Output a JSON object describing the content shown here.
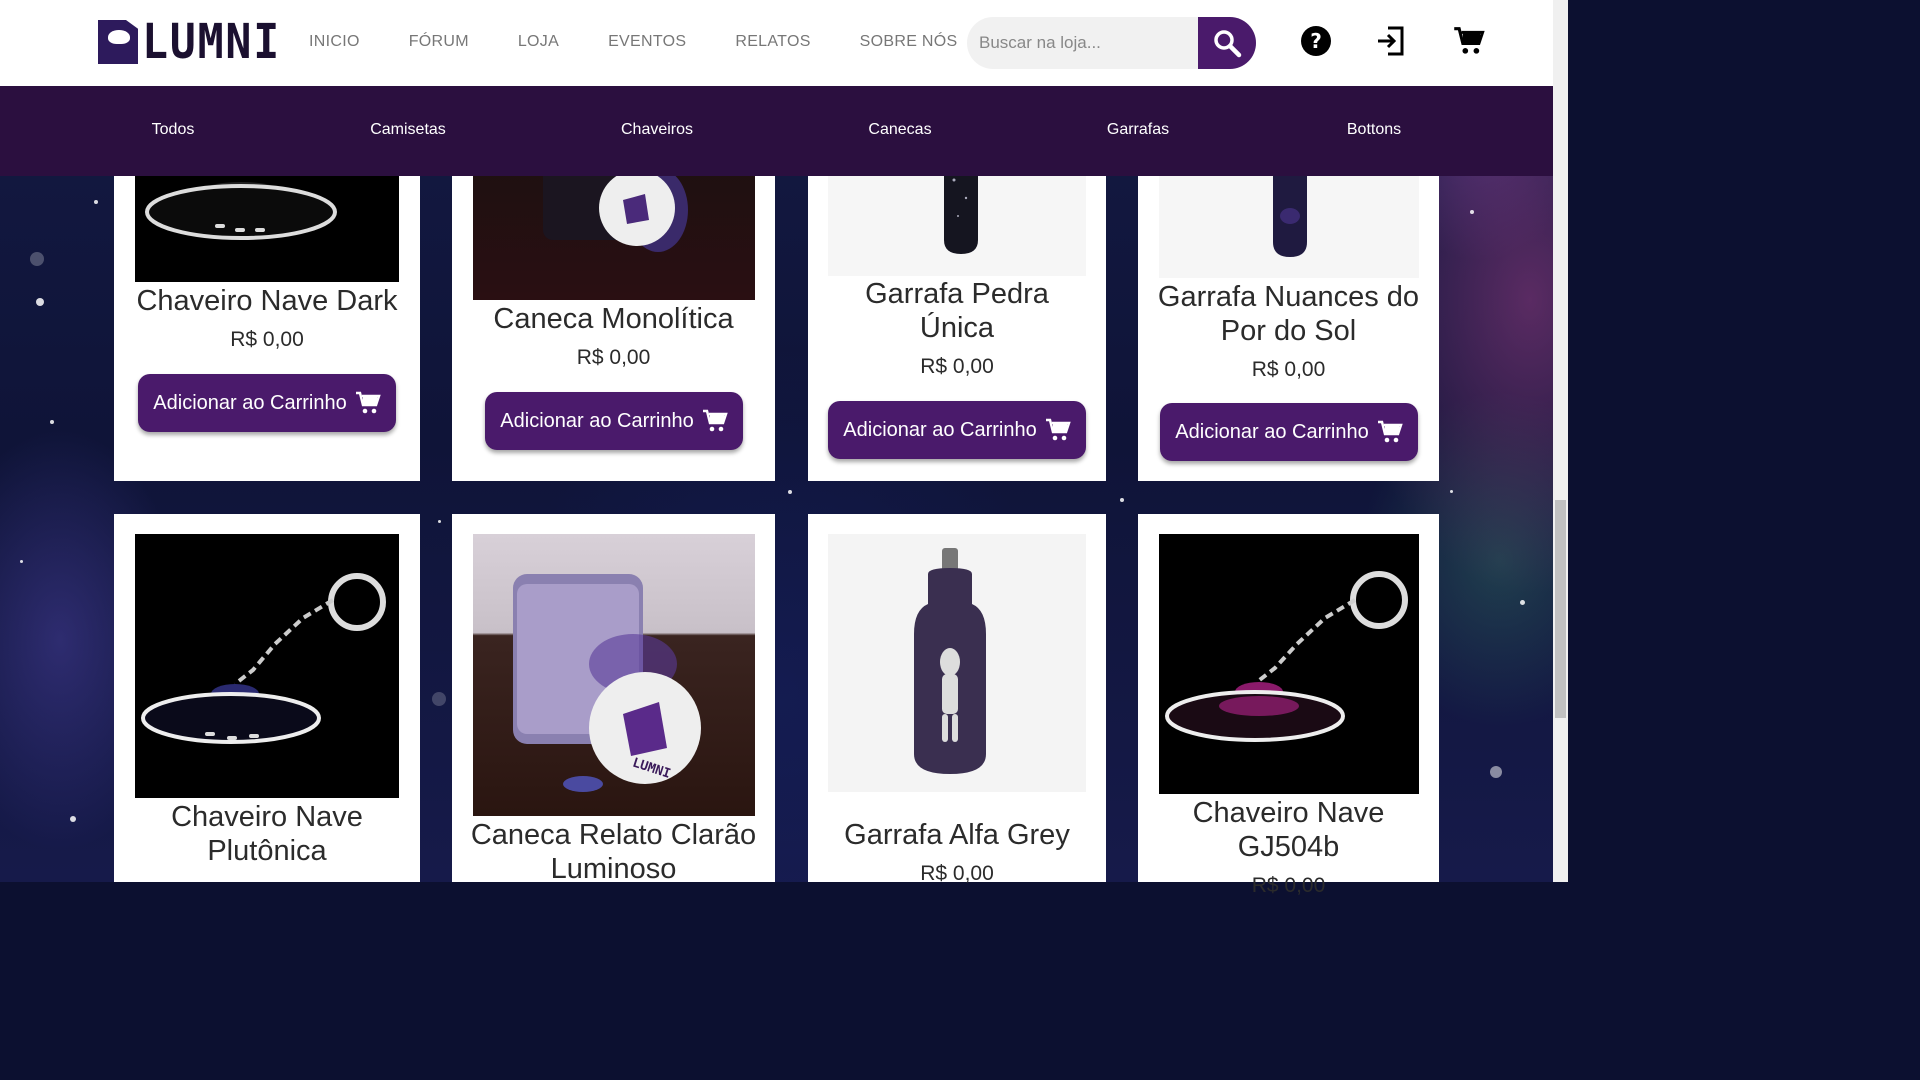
{
  "brand": {
    "logo_text": "LUMNI"
  },
  "nav": [
    "INICIO",
    "FÓRUM",
    "LOJA",
    "EVENTOS",
    "RELATOS",
    "SOBRE NÓS"
  ],
  "search": {
    "placeholder": "Buscar na loja..."
  },
  "header_icons": [
    "help-icon",
    "login-icon",
    "cart-icon"
  ],
  "categories": [
    "Todos",
    "Camisetas",
    "Chaveiros",
    "Canecas",
    "Garrafas",
    "Bottons"
  ],
  "products_row1": [
    {
      "name": "Chaveiro Nave Dark",
      "price": "R$ 0,00",
      "button": "Adicionar ao Carrinho"
    },
    {
      "name": "Caneca Monolítica",
      "price": "R$ 0,00",
      "button": "Adicionar ao Carrinho"
    },
    {
      "name": "Garrafa Pedra Única",
      "price": "R$ 0,00",
      "button": "Adicionar ao Carrinho"
    },
    {
      "name": "Garrafa Nuances do Por do Sol",
      "price": "R$ 0,00",
      "button": "Adicionar ao Carrinho"
    }
  ],
  "products_row2": [
    {
      "name": "Chaveiro Nave Plutônica"
    },
    {
      "name": "Caneca Relato Clarão Luminoso",
      "mug_logo_text": "LUMNI"
    },
    {
      "name": "Garrafa Alfa Grey",
      "price": "R$ 0,00"
    },
    {
      "name": "Chaveiro Nave GJ504b",
      "price": "R$ 0,00"
    }
  ],
  "colors": {
    "primary": "#4a1a6b",
    "category_bar": "#2b0f3f",
    "header_bg": "#ffffff"
  }
}
